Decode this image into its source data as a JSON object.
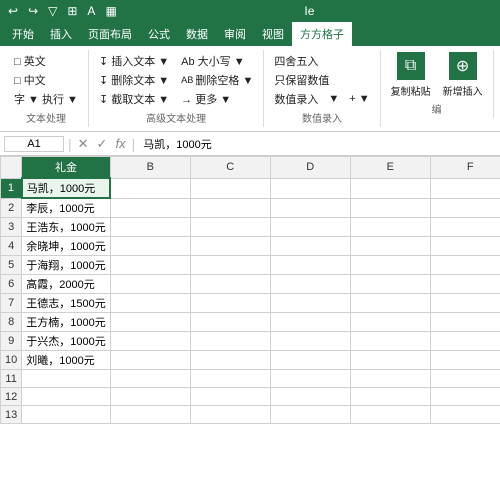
{
  "quick_access": {
    "buttons": [
      "↩",
      "→",
      "▼",
      "▦",
      "A",
      "▦"
    ]
  },
  "ribbon": {
    "tabs": [
      {
        "label": "开始",
        "active": false
      },
      {
        "label": "插入",
        "active": false
      },
      {
        "label": "页面布局",
        "active": false
      },
      {
        "label": "公式",
        "active": false
      },
      {
        "label": "数据",
        "active": false
      },
      {
        "label": "审阅",
        "active": false
      },
      {
        "label": "视图",
        "active": false
      },
      {
        "label": "方方格子",
        "active": true
      }
    ],
    "groups": [
      {
        "label": "文本处理",
        "buttons": [
          {
            "label": "□ 英文",
            "icon": ""
          },
          {
            "label": "□ 中文",
            "icon": ""
          },
          {
            "label": "字 ▼ 执行 ▼",
            "icon": ""
          }
        ]
      },
      {
        "label": "高级文本处理",
        "buttons": [
          {
            "label": "↓↑ 插入文本 ▼",
            "icon": ""
          },
          {
            "label": "↓↑ 删除文本 ▼",
            "icon": ""
          },
          {
            "label": "↓↑ 截取文本 ▼",
            "icon": ""
          }
        ],
        "right_buttons": [
          {
            "label": "Ab 大小写 ▼"
          },
          {
            "label": "AB 删除空格 ▼"
          },
          {
            "label": "→ 更多 ▼"
          }
        ]
      },
      {
        "label": "数值录入",
        "buttons": [
          {
            "label": "四舍五入"
          },
          {
            "label": "只保留数值"
          },
          {
            "label": "数值录入 ▼"
          },
          {
            "label": "+ ▼"
          }
        ]
      },
      {
        "label": "编",
        "buttons": [
          {
            "label": "复制粘贴"
          },
          {
            "label": "新增插入"
          }
        ]
      }
    ]
  },
  "formula_bar": {
    "name_box": "A1",
    "formula_content": "马凯，1000元",
    "icons": [
      "✕",
      "✓",
      "fx"
    ]
  },
  "sheet": {
    "columns": [
      "A",
      "B",
      "C",
      "D",
      "E",
      "F"
    ],
    "col_header_label": "礼金",
    "active_col": "A",
    "rows": [
      {
        "row": 1,
        "a": "马凯，1000元",
        "selected": true
      },
      {
        "row": 2,
        "a": "李辰，1000元"
      },
      {
        "row": 3,
        "a": "王浩东，1000元"
      },
      {
        "row": 4,
        "a": "余晓坤，1000元"
      },
      {
        "row": 5,
        "a": "于海翔，1000元"
      },
      {
        "row": 6,
        "a": "高霞，2000元"
      },
      {
        "row": 7,
        "a": "王德志，1500元"
      },
      {
        "row": 8,
        "a": "王方楠，1000元"
      },
      {
        "row": 9,
        "a": "于兴杰，1000元"
      },
      {
        "row": 10,
        "a": "刘曦，1000元"
      },
      {
        "row": 11,
        "a": ""
      },
      {
        "row": 12,
        "a": ""
      },
      {
        "row": 13,
        "a": ""
      }
    ]
  }
}
